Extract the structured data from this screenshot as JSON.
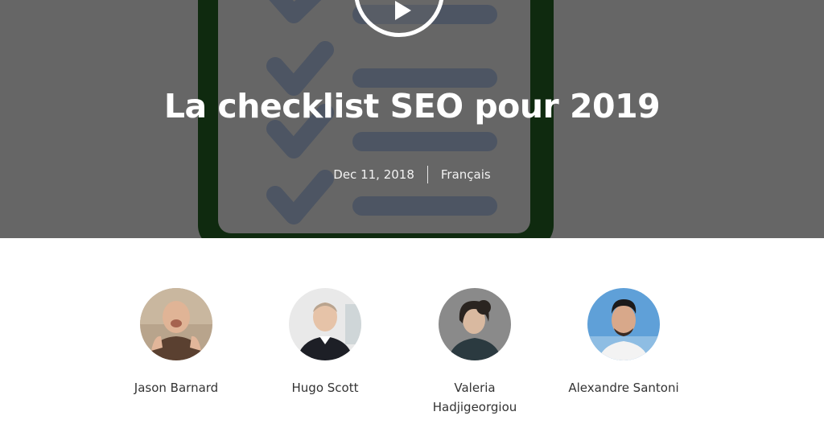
{
  "hero": {
    "title": "La checklist SEO pour 2019",
    "date": "Dec 11, 2018",
    "language": "Français",
    "play_icon": "play-icon",
    "illustration_icon": "checklist-icon"
  },
  "speakers": [
    {
      "name": "Jason Barnard",
      "avatar": "avatar-photo"
    },
    {
      "name": "Hugo Scott",
      "avatar": "avatar-photo"
    },
    {
      "name": "Valeria Hadjigeorgiou",
      "avatar": "avatar-photo"
    },
    {
      "name": "Alexandre Santoni",
      "avatar": "avatar-photo"
    }
  ],
  "colors": {
    "hero_bg": "#666666",
    "checklist_border": "#0b3d0b",
    "checklist_marks": "#4d5563",
    "text_dark": "#333333"
  }
}
